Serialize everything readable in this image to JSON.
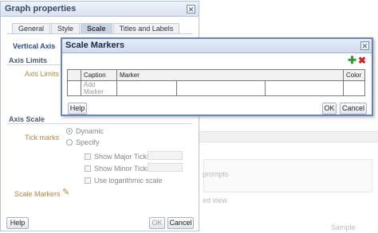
{
  "background": {
    "prompts_fragment": "prompts",
    "view_fragment": "ed view",
    "sample_fragment": "Sample"
  },
  "graph_properties": {
    "title": "Graph properties",
    "close_glyph": "✕",
    "tabs": [
      {
        "label": "General"
      },
      {
        "label": "Style"
      },
      {
        "label": "Scale",
        "active": true
      },
      {
        "label": "Titles and Labels"
      }
    ],
    "vertical_axis_label": "Vertical Axis",
    "axis_limits_heading": "Axis Limits",
    "axis_limits_label": "Axis Limits",
    "axis_scale_heading": "Axis Scale",
    "tick_marks_label": "Tick marks",
    "tick_options": {
      "dynamic": "Dynamic",
      "specify": "Specify",
      "show_major": "Show Major Ticks",
      "show_minor": "Show Minor Ticks",
      "log_scale": "Use logarithmic scale"
    },
    "scale_markers_label": "Scale Markers",
    "edit_icon": "pencil-icon",
    "help_label": "Help",
    "ok_label": "OK",
    "cancel_label": "Cancel"
  },
  "scale_markers": {
    "title": "Scale Markers",
    "close_glyph": "✕",
    "add_icon": "plus-icon",
    "delete_icon": "delete-x-icon",
    "add_color": "#2f9e2f",
    "delete_color": "#d02020",
    "columns": [
      "Caption",
      "Marker",
      "Color"
    ],
    "first_row_caption": "Add Marker",
    "help_label": "Help",
    "ok_label": "OK",
    "cancel_label": "Cancel"
  }
}
